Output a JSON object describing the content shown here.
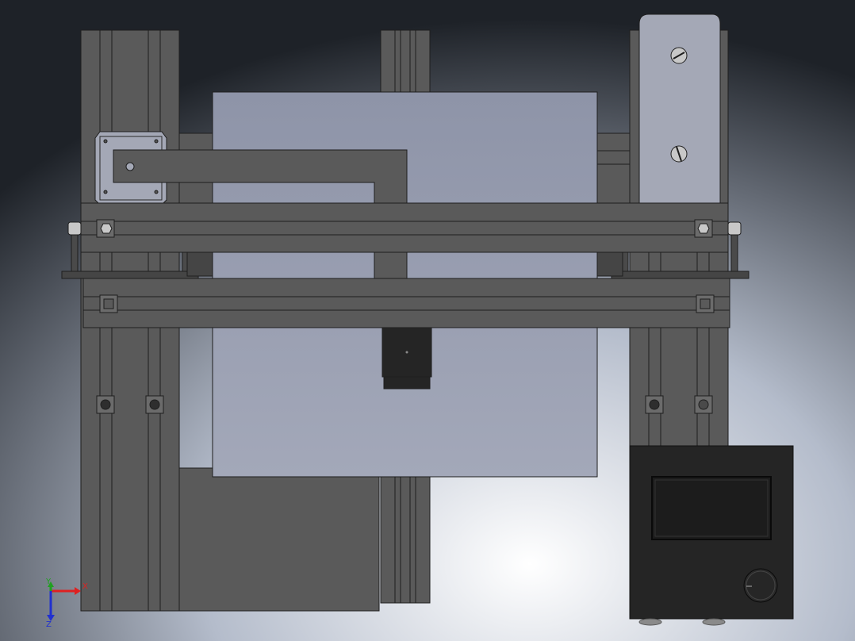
{
  "viewport": {
    "background": {
      "center_color": "#ffffff",
      "mid_color": "#b4bccb",
      "edge_color": "#1e2228"
    }
  },
  "model": {
    "colors": {
      "frame": "#5a5a5a",
      "frame_dark": "#454545",
      "frame_line": "#1e1e1e",
      "bed": "#8e94a8",
      "bed_light": "#a3a8b9",
      "plate": "#a4a8b6",
      "controller_body": "#252525",
      "controller_screen": "#1c1c1c",
      "screw": "#c8c8c8"
    }
  },
  "triad": {
    "x_label": "X",
    "y_label": "Y",
    "z_label": "Z",
    "x_color": "#e02020",
    "y_color": "#20a020",
    "z_color": "#2030d0"
  }
}
